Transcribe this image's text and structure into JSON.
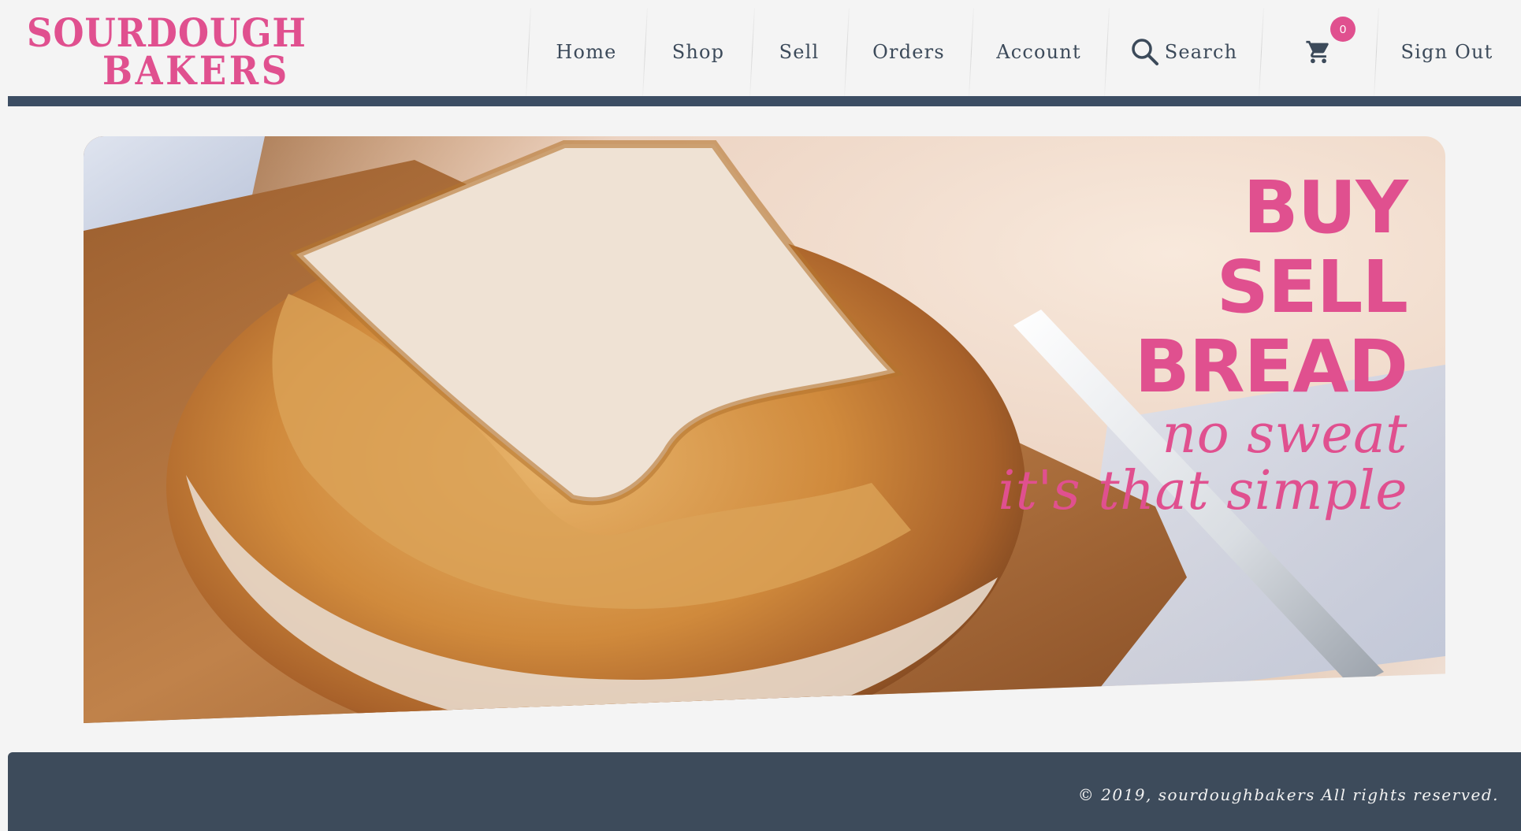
{
  "brand": {
    "line1": "SOURDOUGH",
    "line2": "BAKERS",
    "color": "#e0508f"
  },
  "nav": {
    "items": [
      {
        "label": "Home"
      },
      {
        "label": "Shop"
      },
      {
        "label": "Sell"
      },
      {
        "label": "Orders"
      },
      {
        "label": "Account"
      }
    ],
    "search_label": "Search",
    "search_icon": "search-icon",
    "cart_icon": "cart-icon",
    "cart_count": "0",
    "signout_label": "Sign Out"
  },
  "hero": {
    "headline": [
      "BUY",
      "SELL",
      "BREAD"
    ],
    "tagline1": "no sweat",
    "tagline2": "it's that simple",
    "image": "sourdough-loaf-photo"
  },
  "footer": {
    "copyright": "© 2019, sourdoughbakers All rights reserved."
  },
  "colors": {
    "accent": "#e0508f",
    "navy": "#3c4d63",
    "background": "#f4f4f4"
  }
}
